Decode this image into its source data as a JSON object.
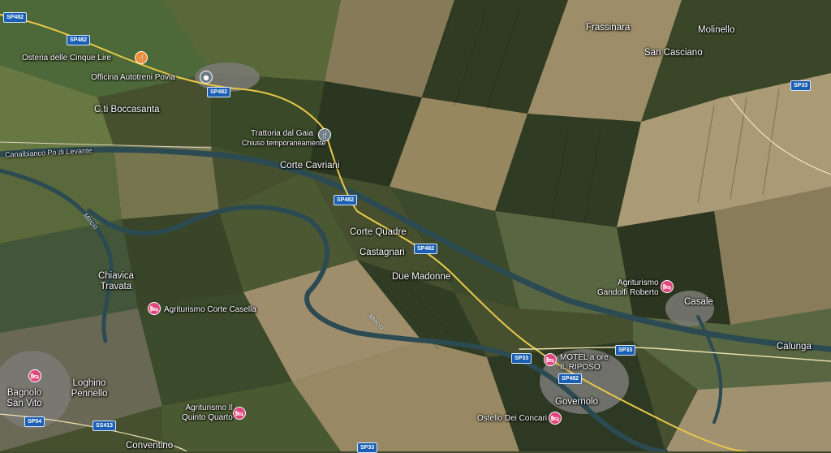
{
  "places": {
    "frassinara": "Frassinara",
    "molinello": "Molinello",
    "san_casciano": "San Casciano",
    "boccasanta": "C.ti Boccasanta",
    "corte_cavriani": "Corte Cavriani",
    "corte_quadre": "Corte Quadre",
    "castagnari": "Castagnari",
    "due_madonne": "Due Madonne",
    "chiavica": "Chiavica\nTravata",
    "casale": "Casale",
    "calunga": "Calunga",
    "bagnolo": "Bagnolo\nSan Vito",
    "loghino": "Loghino\nPennello",
    "governolo": "Governolo",
    "conventino": "Conventino",
    "canale": "Canalbianco Po di Levante",
    "mincio_1": "Mincio",
    "mincio_2": "Mincio"
  },
  "pois": {
    "osteria": {
      "name": "Osteria delle Cinque Lire",
      "icon": "restaurant-icon"
    },
    "officina": {
      "name": "Officina Autotreni Povia",
      "icon": "place-icon"
    },
    "trattoria": {
      "name": "Trattoria dal Gaia",
      "status": "Chiuso temporaneamente",
      "icon": "restaurant-icon"
    },
    "agri_casella": {
      "name": "Agriturismo Corte Casella",
      "icon": "hotel-icon"
    },
    "agri_gandolfi": {
      "name": "Agriturismo\nGandolfi Roberto",
      "icon": "hotel-icon"
    },
    "motel": {
      "name": "MOTEL a ore\nIL RIPOSO",
      "icon": "hotel-icon"
    },
    "agri_quinto": {
      "name": "Agriturismo Il\nQuinto Quarto",
      "icon": "hotel-icon"
    },
    "ostello": {
      "name": "Ostello Dei Concari",
      "icon": "hotel-icon"
    }
  },
  "shields": {
    "sp482_a": "SP482",
    "sp482_b": "SP482",
    "sp482_c": "SP482",
    "sp482_d": "SP482",
    "sp482_e": "SP482",
    "sp482_f": "SP482",
    "sp33_a": "SP33",
    "sp33_b": "SP33",
    "sp33_c": "SP33",
    "sp33_d": "SP33",
    "sp54": "SP54",
    "ss413": "SS413"
  },
  "colors": {
    "pin_lodging": "#e0457b",
    "pin_food": "#f28b30",
    "pin_generic": "#6d7c86",
    "road_shield": "#1a5fb4",
    "road": "#e8c84a"
  }
}
